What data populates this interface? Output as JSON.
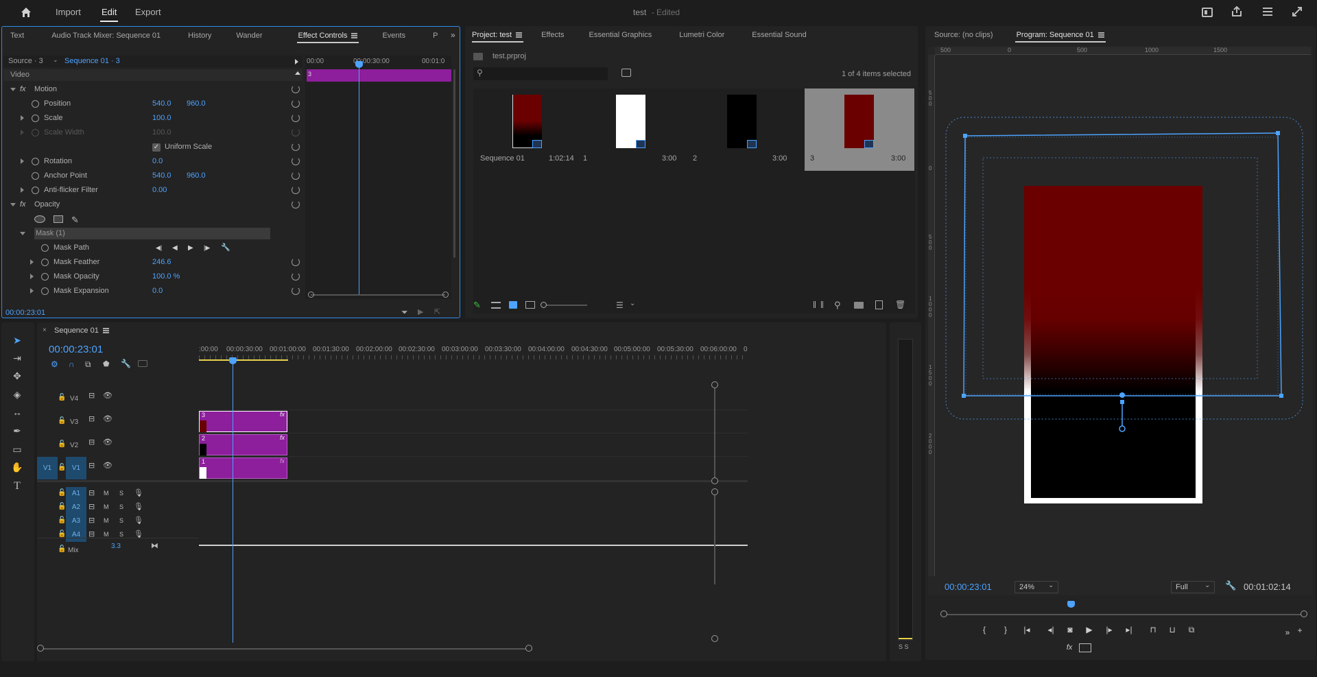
{
  "header": {
    "menu": [
      "Import",
      "Edit",
      "Export"
    ],
    "active_menu": "Edit",
    "project_name": "test",
    "edited_status": "- Edited"
  },
  "left_tabs": [
    "Text",
    "Audio Track Mixer: Sequence 01",
    "History",
    "Wander",
    "Effect Controls",
    "Events",
    "P"
  ],
  "effect_controls": {
    "source_label": "Source · 3",
    "sequence_label": "Sequence 01 · 3",
    "ruler": [
      "00:00",
      "00:00:30:00",
      "00:01:0"
    ],
    "clip_name": "3",
    "section": "Video",
    "motion": "Motion",
    "position": {
      "label": "Position",
      "x": "540.0",
      "y": "960.0"
    },
    "scale": {
      "label": "Scale",
      "value": "100.0"
    },
    "scale_width": {
      "label": "Scale Width",
      "value": "100.0"
    },
    "uniform_scale": "Uniform Scale",
    "rotation": {
      "label": "Rotation",
      "value": "0.0"
    },
    "anchor": {
      "label": "Anchor Point",
      "x": "540.0",
      "y": "960.0"
    },
    "antiflicker": {
      "label": "Anti-flicker Filter",
      "value": "0.00"
    },
    "opacity": "Opacity",
    "mask": "Mask (1)",
    "mask_path": "Mask Path",
    "mask_feather": {
      "label": "Mask Feather",
      "value": "246.6"
    },
    "mask_opacity": {
      "label": "Mask Opacity",
      "value": "100.0 %"
    },
    "mask_expansion": {
      "label": "Mask Expansion",
      "value": "0.0"
    },
    "timecode": "00:00:23:01"
  },
  "project": {
    "tabs": [
      "Project: test",
      "Effects",
      "Essential Graphics",
      "Lumetri Color",
      "Essential Sound"
    ],
    "file": "test.prproj",
    "search_placeholder": "",
    "selection": "1 of 4 items selected",
    "items": [
      {
        "name": "Sequence 01",
        "duration": "1:02:14"
      },
      {
        "name": "1",
        "duration": "3:00"
      },
      {
        "name": "2",
        "duration": "3:00"
      },
      {
        "name": "3",
        "duration": "3:00"
      }
    ]
  },
  "monitor": {
    "source_tab": "Source: (no clips)",
    "program_tab": "Program: Sequence 01",
    "ruler": [
      "500",
      "0",
      "500",
      "1000",
      "1500"
    ],
    "vruler": [
      "5\n0\n0",
      "0",
      "5\n0\n0",
      "1\n0\n0\n0",
      "1\n5\n0\n0",
      "2\n0\n0\n0"
    ],
    "timecode": "00:00:23:01",
    "zoom": "24%",
    "quality": "Full",
    "duration": "00:01:02:14"
  },
  "timeline": {
    "sequence_name": "Sequence 01",
    "timecode": "00:00:23:01",
    "ruler": [
      ":00:00",
      "00:00:30:00",
      "00:01:00:00",
      "00:01:30:00",
      "00:02:00:00",
      "00:02:30:00",
      "00:03:00:00",
      "00:03:30:00",
      "00:04:00:00",
      "00:04:30:00",
      "00:05:00:00",
      "00:05:30:00",
      "00:06:00:00",
      "0"
    ],
    "video_tracks": [
      "V4",
      "V3",
      "V2",
      "V1"
    ],
    "source_patch": "V1",
    "audio_tracks": [
      "A1",
      "A2",
      "A3",
      "A4"
    ],
    "mute": "M",
    "solo": "S",
    "mix_label": "Mix",
    "mix_value": "3.3",
    "clips": [
      "3",
      "2",
      "1"
    ],
    "fx": "fx",
    "meter_labels": "S S"
  },
  "colors": {
    "accent": "#4da3ff",
    "clip": "#8d1e9c",
    "track_patch": "#1e4a6e",
    "dark_red": "#6b0000"
  }
}
